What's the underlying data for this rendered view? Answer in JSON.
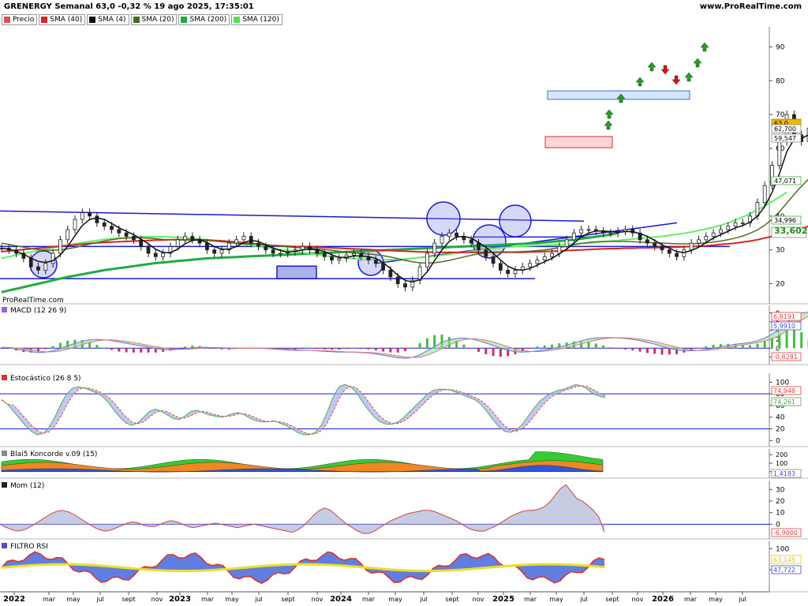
{
  "header": {
    "title": "GRENERGY Semanal 63,0 -0,32 % 19 ago 2025, 17:35:01",
    "brand": "www.ProRealTime.com"
  },
  "legend": [
    {
      "label": "Precio",
      "color": "#e05050"
    },
    {
      "label": "SMA (40)",
      "color": "#dd2222"
    },
    {
      "label": "SMA (4)",
      "color": "#111111"
    },
    {
      "label": "SMA (20)",
      "color": "#4a6a20"
    },
    {
      "label": "SMA (200)",
      "color": "#22aa44"
    },
    {
      "label": "SMA (120)",
      "color": "#55dd55"
    }
  ],
  "watermark": "ProRealTime.com",
  "x_axis": [
    "2022",
    "mar",
    "may",
    "jul",
    "sept",
    "nov",
    "2023",
    "mar",
    "may",
    "jul",
    "sept",
    "nov",
    "2024",
    "mar",
    "may",
    "jul",
    "sept",
    "nov",
    "2025",
    "mar",
    "may",
    "jul",
    "sept",
    "nov",
    "2026",
    "mar",
    "may",
    "jul"
  ],
  "x_axis_bold": [
    "2022",
    "2023",
    "2024",
    "2025",
    "2026"
  ],
  "chart_data": [
    {
      "type": "candlestick",
      "title": "GRENERGY Semanal",
      "y_ticks": [
        20,
        30,
        40,
        50,
        60,
        70,
        80,
        90
      ],
      "ylim": [
        15,
        95
      ],
      "value_labels": [
        {
          "text": "63,0",
          "color": "#e8a000"
        },
        {
          "text": "62,700",
          "color": "#ffffff"
        },
        {
          "text": "59,547",
          "color": "#ffffff"
        },
        {
          "text": "47,071",
          "color": "#ffffff"
        },
        {
          "text": "34,996",
          "color": "#ffffff"
        },
        {
          "text": "33,602",
          "color": "#ffffff"
        }
      ],
      "price_series": [
        30.5,
        30,
        29,
        27.5,
        25,
        24,
        26,
        29,
        33,
        36,
        39,
        41,
        40,
        38,
        37,
        36,
        35,
        34,
        33,
        31,
        29,
        28,
        29,
        31,
        33,
        34,
        33,
        32,
        30,
        29,
        30,
        32,
        33,
        34,
        32,
        31,
        30,
        29,
        29,
        29.5,
        30,
        31,
        30,
        29,
        28,
        27,
        27.5,
        28.5,
        29,
        28,
        27,
        26,
        24,
        22,
        20,
        19,
        21,
        25,
        29,
        32,
        34,
        35,
        34,
        33,
        32,
        30,
        28,
        26,
        24,
        23,
        24,
        25,
        26,
        27,
        28,
        29,
        31,
        33,
        35,
        36,
        36,
        35.5,
        35,
        35,
        35.5,
        36,
        35,
        33,
        32,
        31,
        30,
        29,
        28,
        30,
        32,
        33,
        34,
        35,
        36,
        37,
        38,
        38,
        40,
        44,
        49,
        55,
        62,
        70,
        64,
        62,
        66,
        64,
        62,
        60,
        63
      ],
      "sma4": [
        30.5,
        30.2,
        29.6,
        28.7,
        27.6,
        26.6,
        26.3,
        26.8,
        28.5,
        31,
        34.2,
        37.2,
        39,
        39.5,
        39,
        37.8,
        36.5,
        35.5,
        34.5,
        33.2,
        31.8,
        30.2,
        29.2,
        29.2,
        30.2,
        31.8,
        32.8,
        33,
        32.2,
        31,
        30.2,
        30.2,
        31,
        32.2,
        32.8,
        32.5,
        31.5,
        30.5,
        29.8,
        29.3,
        29.6,
        30,
        30.2,
        30,
        29.5,
        28.5,
        27.8,
        27.8,
        28.2,
        28.2,
        28,
        27.5,
        26.2,
        24.5,
        22.5,
        21,
        20.5,
        21.2,
        23.5,
        26.8,
        30,
        32.5,
        33.8,
        34,
        33.5,
        32.2,
        30.8,
        29,
        27,
        25.2,
        24.2,
        24,
        24.5,
        25.5,
        26.5,
        27.5,
        28.8,
        30.2,
        32,
        33.8,
        35,
        35.6,
        35.6,
        35.4,
        35.2,
        35.4,
        35.4,
        34.8,
        34,
        32.8,
        31.5,
        30.5,
        29.5,
        29.2,
        29.8,
        30.8,
        32.2,
        33.5,
        34.5,
        35.5,
        36.5,
        37.2,
        38.2,
        40,
        42.8,
        47,
        52.5,
        59,
        62.8,
        63,
        64,
        64.5,
        63.5,
        63,
        62.7
      ],
      "sma20": [
        32,
        31.6,
        31.2,
        30.8,
        30.4,
        30.1,
        29.9,
        29.9,
        30,
        30.3,
        30.7,
        31.2,
        31.7,
        32.2,
        32.6,
        33,
        33.3,
        33.5,
        33.6,
        33.6,
        33.5,
        33.3,
        33.1,
        33,
        32.9,
        32.9,
        32.9,
        32.9,
        32.8,
        32.6,
        32.4,
        32.2,
        32,
        31.8,
        31.7,
        31.6,
        31.5,
        31.3,
        31.1,
        30.9,
        30.7,
        30.6,
        30.5,
        30.3,
        30.1,
        29.9,
        29.6,
        29.3,
        29.1,
        28.9,
        28.8,
        28.6,
        28.3,
        27.9,
        27.4,
        26.9,
        26.5,
        26.2,
        26.1,
        26.2,
        26.5,
        26.9,
        27.4,
        27.9,
        28.4,
        28.8,
        29.1,
        29.3,
        29.4,
        29.4,
        29.4,
        29.5,
        29.6,
        29.8,
        30,
        30.3,
        30.7,
        31.1,
        31.5,
        31.9,
        32.2,
        32.4,
        32.5,
        32.5,
        32.5,
        32.5,
        32.4,
        32.3,
        32.2,
        32.1,
        32,
        31.9,
        31.8,
        31.8,
        31.8,
        31.9,
        32.1,
        32.3,
        32.6,
        33,
        33.5,
        34.1,
        34.9,
        35.9,
        37.3,
        39.1,
        41.3,
        43.8,
        46.4,
        48.8,
        51,
        53.1,
        55,
        56.6,
        58.1,
        59.5
      ],
      "sma40": [
        29.5,
        29.7,
        29.9,
        30.1,
        30.3,
        30.5,
        30.7,
        30.9,
        31.1,
        31.3,
        31.5,
        31.7,
        31.9,
        32.1,
        32.2,
        32.3,
        32.4,
        32.5,
        32.6,
        32.7,
        32.8,
        32.9,
        32.9,
        33,
        33,
        33,
        33,
        33,
        32.9,
        32.8,
        32.7,
        32.5,
        32.3,
        32.1,
        31.9,
        31.7,
        31.5,
        31.3,
        31.2,
        31.1,
        31,
        30.9,
        30.9,
        30.8,
        30.7,
        30.6,
        30.5,
        30.4,
        30.3,
        30.2,
        30.1,
        30,
        29.9,
        29.8,
        29.7,
        29.6,
        29.5,
        29.4,
        29.4,
        29.3,
        29.3,
        29.3,
        29.3,
        29.3,
        29.3,
        29.3,
        29.3,
        29.3,
        29.3,
        29.3,
        29.3,
        29.3,
        29.4,
        29.4,
        29.5,
        29.6,
        29.7,
        29.8,
        29.9,
        30,
        30.1,
        30.2,
        30.3,
        30.4,
        30.4,
        30.5,
        30.5,
        30.6,
        30.6,
        30.7,
        30.7,
        30.8,
        30.8,
        30.9,
        31,
        31.1,
        31.2,
        31.4,
        31.6,
        31.8,
        32,
        32.3,
        32.6,
        33,
        33.5,
        34,
        34.6,
        35.2,
        35.8,
        36.4,
        37,
        37.6,
        38.2,
        38.8,
        39.4,
        40
      ],
      "sma120": [
        27.5,
        28,
        28.5,
        29,
        29.4,
        29.8,
        30.2,
        30.6,
        31,
        31.4,
        31.8,
        32.2,
        32.5,
        32.8,
        33.1,
        33.3,
        33.5,
        33.6,
        33.7,
        33.8,
        33.9,
        33.9,
        33.9,
        33.8,
        33.7,
        33.6,
        33.4,
        33.2,
        33,
        32.8,
        32.5,
        32.2,
        31.9,
        31.6,
        31.3,
        31,
        30.7,
        30.4,
        30.1,
        29.8,
        29.5,
        29.2,
        28.9,
        28.6,
        28.3,
        28,
        27.8,
        27.6,
        27.4,
        27.3,
        27.2,
        27.1,
        27.1,
        27.1,
        27.2,
        27.3,
        27.5,
        27.7,
        27.9,
        28.1,
        28.4,
        28.7,
        29,
        29.3,
        29.6,
        29.9,
        30.2,
        30.4,
        30.6,
        30.8,
        31,
        31.1,
        31.2,
        31.3,
        31.4,
        31.5,
        31.6,
        31.7,
        31.8,
        31.9,
        32,
        32.2,
        32.4,
        32.6,
        32.8,
        33,
        33.2,
        33.4,
        33.6,
        33.8,
        34,
        34.3,
        34.6,
        34.9,
        35.3,
        35.7,
        36.2,
        36.7,
        37.3,
        38,
        38.8,
        39.7,
        40.7,
        41.8,
        43,
        44.3,
        45.6,
        47.1
      ],
      "sma200": [
        17.5,
        18,
        18.5,
        19,
        19.5,
        20,
        20.5,
        21,
        21.5,
        22,
        22.4,
        22.8,
        23.2,
        23.6,
        24,
        24.3,
        24.6,
        24.9,
        25.2,
        25.5,
        25.8,
        26.1,
        26.3,
        26.5,
        26.7,
        26.9,
        27.1,
        27.3,
        27.5,
        27.6,
        27.7,
        27.8,
        27.9,
        28,
        28.1,
        28.2,
        28.3,
        28.4,
        28.5,
        28.6,
        28.7,
        28.8,
        28.9,
        29,
        29.1,
        29.2,
        29.3,
        29.4,
        29.5,
        29.6,
        29.7,
        29.8,
        29.9,
        30,
        30.1,
        30.2,
        30.3,
        30.4,
        30.5,
        30.6,
        30.7,
        30.8,
        30.9,
        31,
        31.1,
        31.2,
        31.3,
        31.4,
        31.5,
        31.6,
        31.7,
        31.8,
        31.9,
        32,
        32.2,
        32.4,
        32.6,
        32.8,
        33,
        33.3,
        33.6,
        33.9,
        34.2,
        34.5,
        35
      ]
    },
    {
      "type": "line",
      "title": "MACD (12 26 9)",
      "y_ticks": [
        8,
        6,
        4,
        2,
        0,
        -2
      ],
      "ylim": [
        -3,
        9
      ],
      "value_labels": [
        {
          "text": "6,8191",
          "color": "#dd4444"
        },
        {
          "text": "5,9910",
          "color": "#4444dd"
        },
        {
          "text": "-0,8281",
          "color": "#dd4444"
        }
      ],
      "macd": [
        0.2,
        0.1,
        -0.2,
        -0.5,
        -0.8,
        -1,
        -0.9,
        -0.6,
        -0.1,
        0.5,
        1.1,
        1.6,
        1.9,
        2,
        1.9,
        1.7,
        1.4,
        1.1,
        0.8,
        0.5,
        0.2,
        -0.1,
        -0.3,
        -0.4,
        -0.3,
        -0.1,
        0.1,
        0.2,
        0.2,
        0.1,
        0,
        -0.1,
        -0.1,
        0,
        0,
        0,
        -0.1,
        -0.2,
        -0.3,
        -0.4,
        -0.5,
        -0.5,
        -0.5,
        -0.6,
        -0.7,
        -0.8,
        -0.9,
        -0.9,
        -0.9,
        -1,
        -1.1,
        -1.3,
        -1.6,
        -1.9,
        -2.2,
        -2.3,
        -2.1,
        -1.5,
        -0.6,
        0.4,
        1.3,
        1.9,
        2.2,
        2.3,
        2.1,
        1.7,
        1.2,
        0.6,
        0,
        -0.5,
        -0.8,
        -0.9,
        -0.8,
        -0.6,
        -0.4,
        -0.1,
        0.3,
        0.7,
        1.2,
        1.7,
        2.1,
        2.3,
        2.4,
        2.4,
        2.3,
        2.2,
        2,
        1.7,
        1.3,
        0.9,
        0.4,
        0,
        -0.4,
        -0.6,
        -0.6,
        -0.5,
        -0.3,
        0,
        0.3,
        0.6,
        0.9,
        1.1,
        1.3,
        1.7,
        2.3,
        3.2,
        4.4,
        5.8,
        7.2,
        8,
        8.2,
        8.1,
        7.8,
        7.4,
        7,
        6.8
      ]
    },
    {
      "type": "line",
      "title": "Estocástico (26 8 5)",
      "y_ticks": [
        100,
        80,
        60,
        40,
        20,
        0
      ],
      "ylim": [
        -5,
        110
      ],
      "value_labels": [
        {
          "text": "74,948",
          "color": "#dd4444"
        },
        {
          "text": "74,261",
          "color": "#44aa44"
        }
      ],
      "stoch": [
        70,
        62,
        50,
        38,
        26,
        16,
        10,
        12,
        22,
        40,
        62,
        80,
        90,
        92,
        90,
        86,
        82,
        76,
        66,
        52,
        40,
        30,
        26,
        30,
        40,
        50,
        54,
        50,
        44,
        38,
        36,
        42,
        50,
        52,
        48,
        44,
        42,
        40,
        42,
        46,
        48,
        44,
        38,
        34,
        32,
        32,
        34,
        30,
        26,
        20,
        14,
        10,
        10,
        14,
        26,
        48,
        74,
        92,
        96,
        92,
        82,
        66,
        52,
        40,
        32,
        28,
        28,
        32,
        40,
        50,
        60,
        70,
        80,
        86,
        88,
        88,
        86,
        82,
        78,
        74,
        70,
        62,
        50,
        36,
        24,
        16,
        14,
        18,
        28,
        42,
        56,
        68,
        76,
        82,
        86,
        88,
        92,
        96,
        94,
        88,
        80,
        76,
        74
      ]
    },
    {
      "type": "area",
      "title": "Blai5 Koncorde v.09 (15)",
      "y_ticks": [
        200,
        100,
        0
      ],
      "ylim": [
        -40,
        230
      ],
      "value_labels": [
        {
          "text": "1,4183",
          "color": "#ffffff"
        }
      ]
    },
    {
      "type": "area",
      "title": "Mom (12)",
      "y_ticks": [
        30,
        20,
        10,
        0
      ],
      "ylim": [
        -10,
        35
      ],
      "value_labels": [
        {
          "text": "-6,9000",
          "color": "#dd4444"
        }
      ],
      "mom": [
        -1,
        -3,
        -5,
        -6,
        -5,
        -3,
        0,
        3,
        6,
        9,
        11,
        12,
        11,
        9,
        6,
        3,
        0,
        -3,
        -5,
        -6,
        -5,
        -3,
        -1,
        1,
        2,
        1,
        -1,
        -2,
        -2,
        0,
        2,
        3,
        2,
        0,
        -2,
        -3,
        -2,
        -1,
        0,
        1,
        0,
        -1,
        -2,
        -3,
        -2,
        -1,
        0,
        -1,
        -2,
        -3,
        -4,
        -5,
        -6,
        -7,
        -5,
        -2,
        3,
        8,
        12,
        14,
        12,
        8,
        4,
        0,
        -3,
        -6,
        -8,
        -8,
        -6,
        -3,
        0,
        3,
        5,
        7,
        9,
        10,
        11,
        12,
        12,
        11,
        9,
        7,
        5,
        3,
        0,
        -3,
        -5,
        -6,
        -6,
        -4,
        -2,
        1,
        4,
        7,
        9,
        11,
        12,
        12,
        13,
        15,
        19,
        25,
        31,
        34,
        28,
        22,
        20,
        16,
        12,
        6,
        -7
      ]
    },
    {
      "type": "line",
      "title": "FILTRO RSI",
      "y_ticks": [
        100,
        50
      ],
      "ylim": [
        5,
        110
      ],
      "value_labels": [
        {
          "text": "63,145",
          "color": "#e8c800"
        },
        {
          "text": "47,722",
          "color": "#4444dd"
        }
      ]
    }
  ]
}
